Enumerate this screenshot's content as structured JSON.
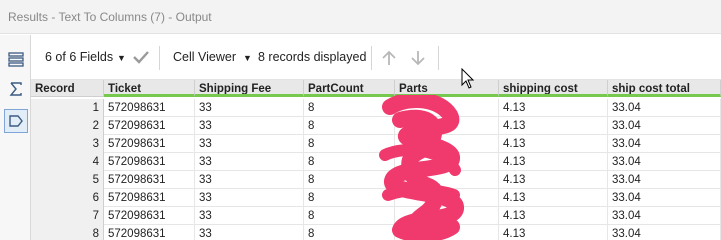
{
  "window": {
    "title": "Results - Text To Columns (7) - Output"
  },
  "toolbar": {
    "fields_label": "6 of 6 Fields",
    "viewer_label": "Cell Viewer",
    "records_label": "8 records displayed"
  },
  "colors": {
    "accent": "#76c84e",
    "redaction": "#f03a6e"
  },
  "table": {
    "headers": [
      "Record",
      "Ticket",
      "Shipping Fee",
      "PartCount",
      "Parts",
      "shipping cost",
      "ship cost total"
    ],
    "rows": [
      [
        "1",
        "572098631",
        "33",
        "8",
        "",
        "4.13",
        "33.04"
      ],
      [
        "2",
        "572098631",
        "33",
        "8",
        "",
        "4.13",
        "33.04"
      ],
      [
        "3",
        "572098631",
        "33",
        "8",
        "",
        "4.13",
        "33.04"
      ],
      [
        "4",
        "572098631",
        "33",
        "8",
        "",
        "4.13",
        "33.04"
      ],
      [
        "5",
        "572098631",
        "33",
        "8",
        "",
        "4.13",
        "33.04"
      ],
      [
        "6",
        "572098631",
        "33",
        "8",
        "",
        "4.13",
        "33.04"
      ],
      [
        "7",
        "572098631",
        "33",
        "8",
        "",
        "4.13",
        "33.04"
      ],
      [
        "8",
        "572098631",
        "33",
        "8",
        "",
        "4.13",
        "33.04"
      ]
    ]
  }
}
